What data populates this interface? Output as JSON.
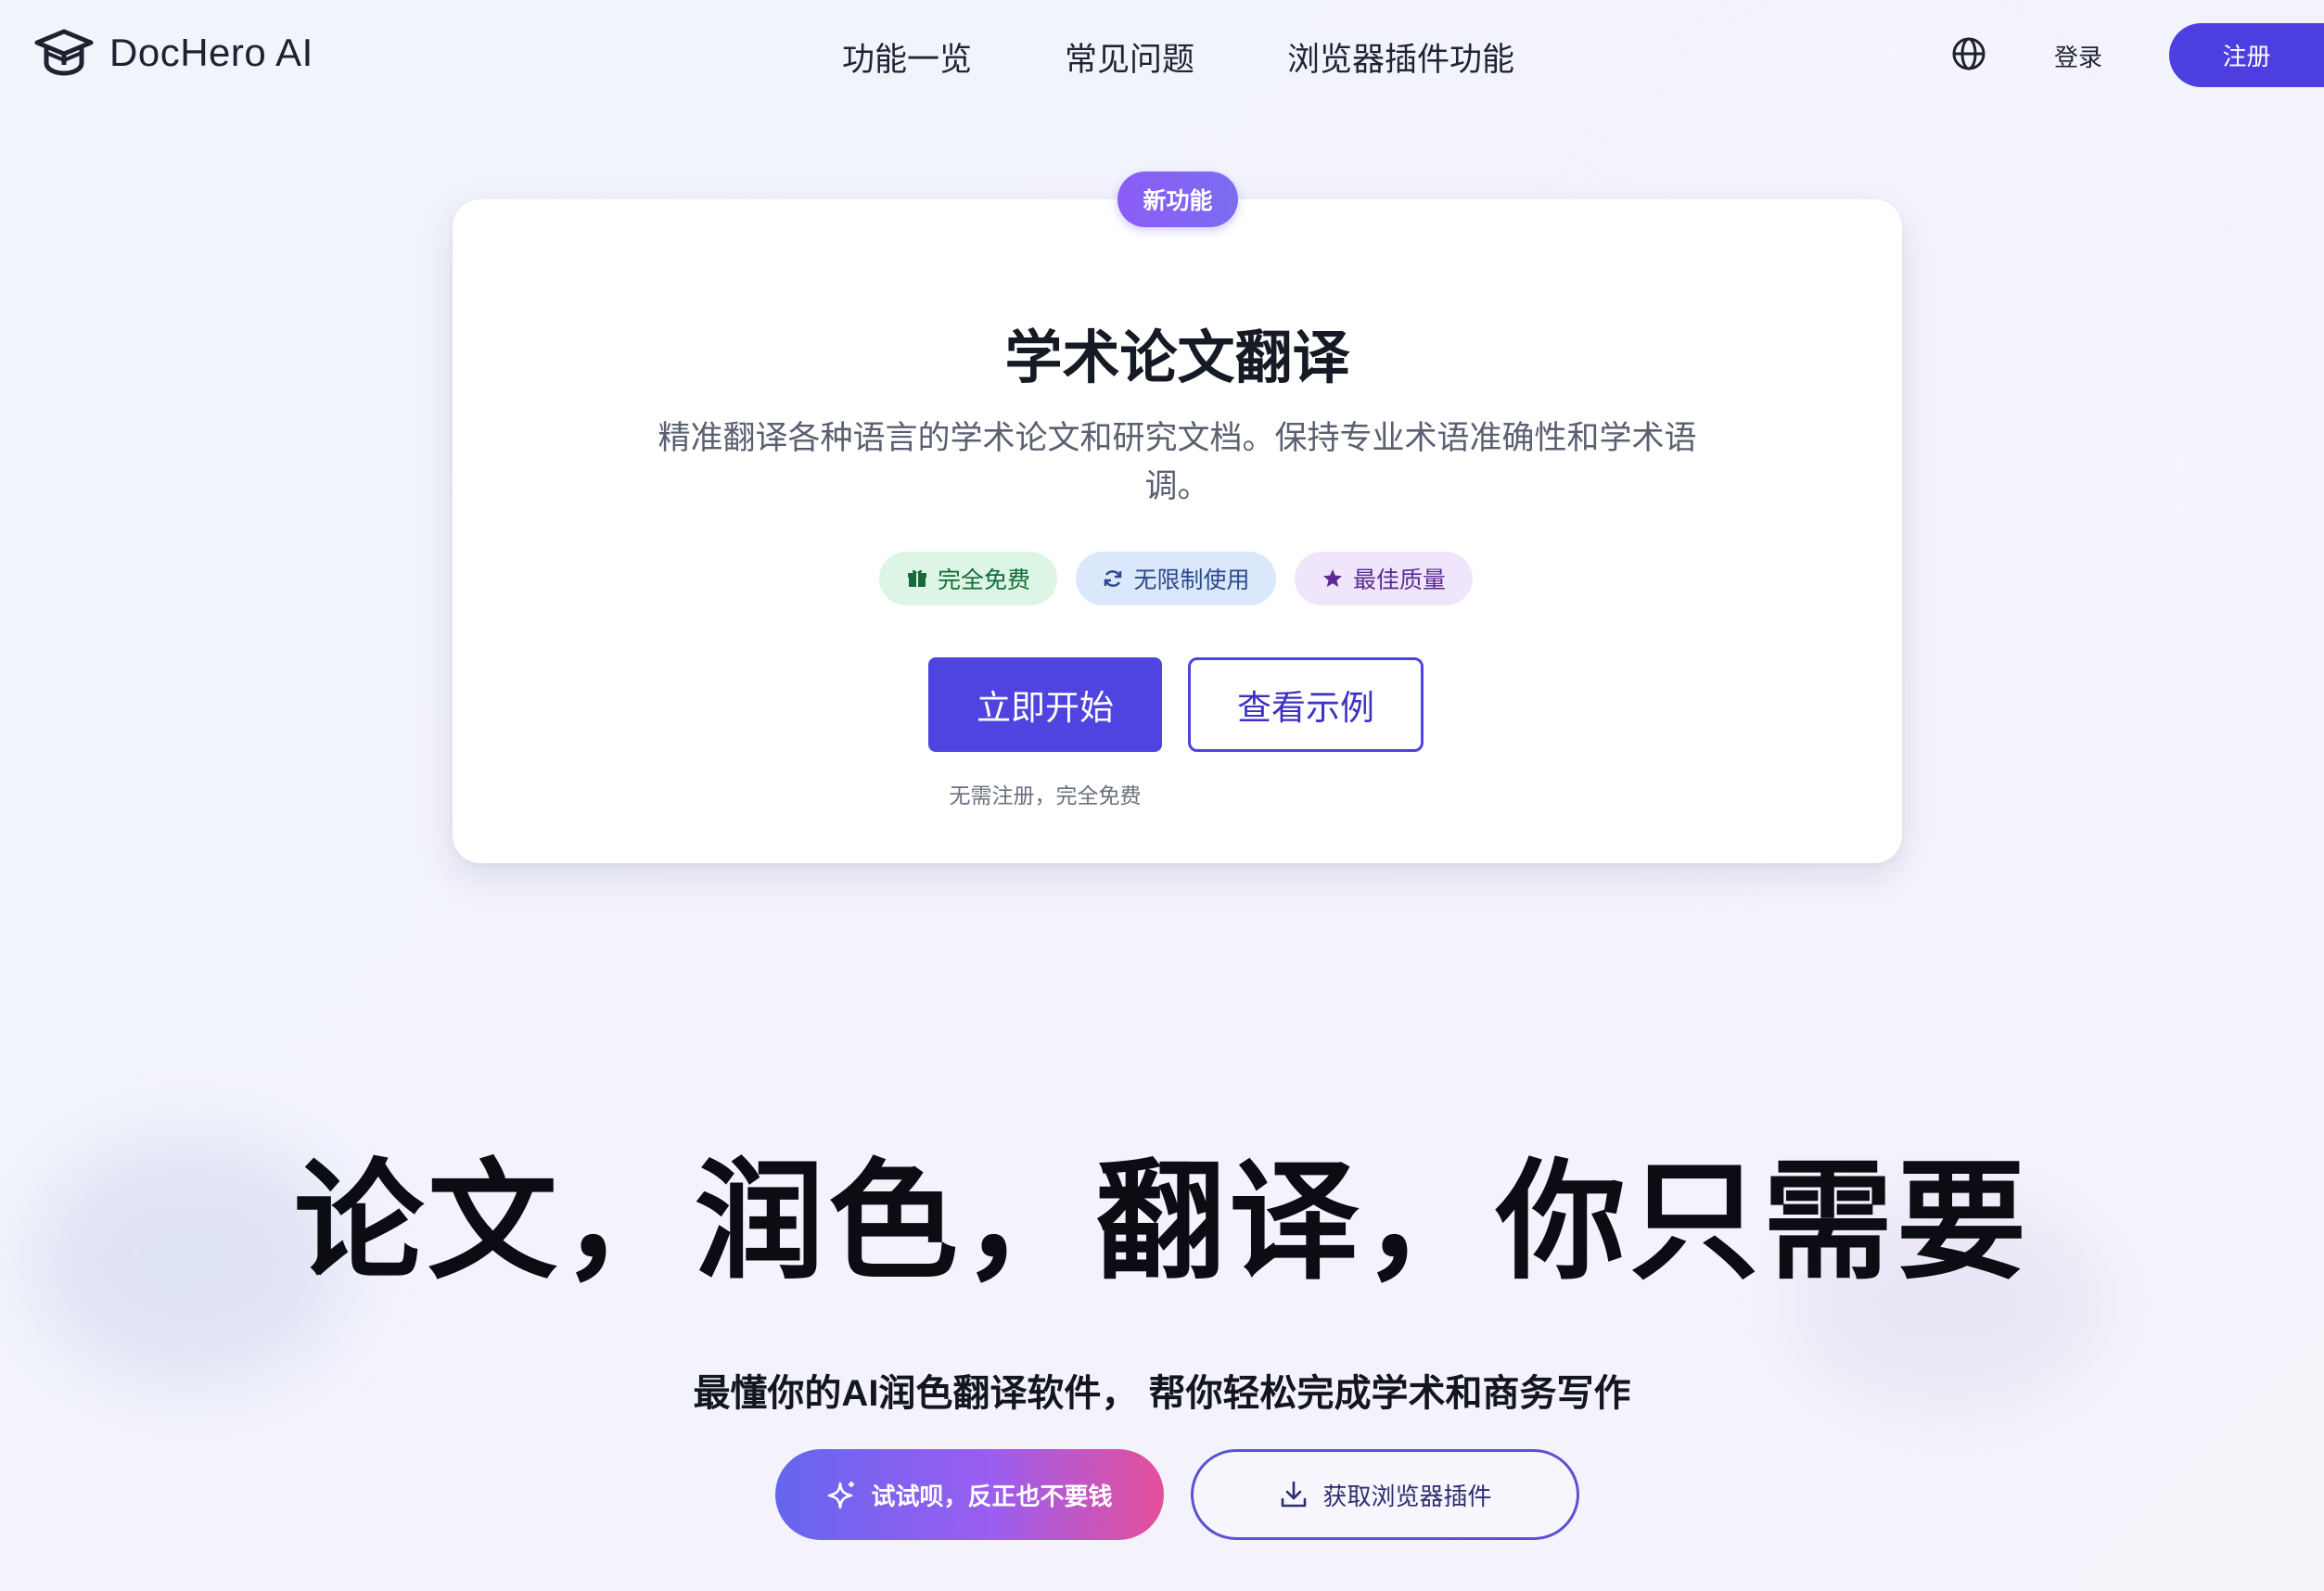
{
  "brand": {
    "name": "DocHero AI",
    "logo_icon": "graduation-cap-icon"
  },
  "nav": {
    "links": [
      "功能一览",
      "常见问题",
      "浏览器插件功能"
    ],
    "language_icon": "globe-icon",
    "login_label": "登录",
    "signup_label": "注册",
    "accent_color": "#4d3ee0"
  },
  "card": {
    "badge": "新功能",
    "title": "学术论文翻译",
    "description": "精准翻译各种语言的学术论文和研究文档。保持专业术语准确性和学术语调。",
    "chips": [
      {
        "icon": "gift-icon",
        "label": "完全免费",
        "color": "#176a3a"
      },
      {
        "icon": "refresh-icon",
        "label": "无限制使用",
        "color": "#2b4a8c"
      },
      {
        "icon": "star-icon",
        "label": "最佳质量",
        "color": "#5b2a94"
      }
    ],
    "primary_button": "立即开始",
    "secondary_button": "查看示例",
    "note": "无需注册，完全免费"
  },
  "hero": {
    "title": "论文，润色，翻译，你只需要",
    "subtitle": "最懂你的AI润色翻译软件， 帮你轻松完成学术和商务写作",
    "try_button": {
      "icon": "sparkle-icon",
      "label": "试试呗，反正也不要钱"
    },
    "plugin_button": {
      "icon": "download-icon",
      "label": "获取浏览器插件"
    }
  }
}
